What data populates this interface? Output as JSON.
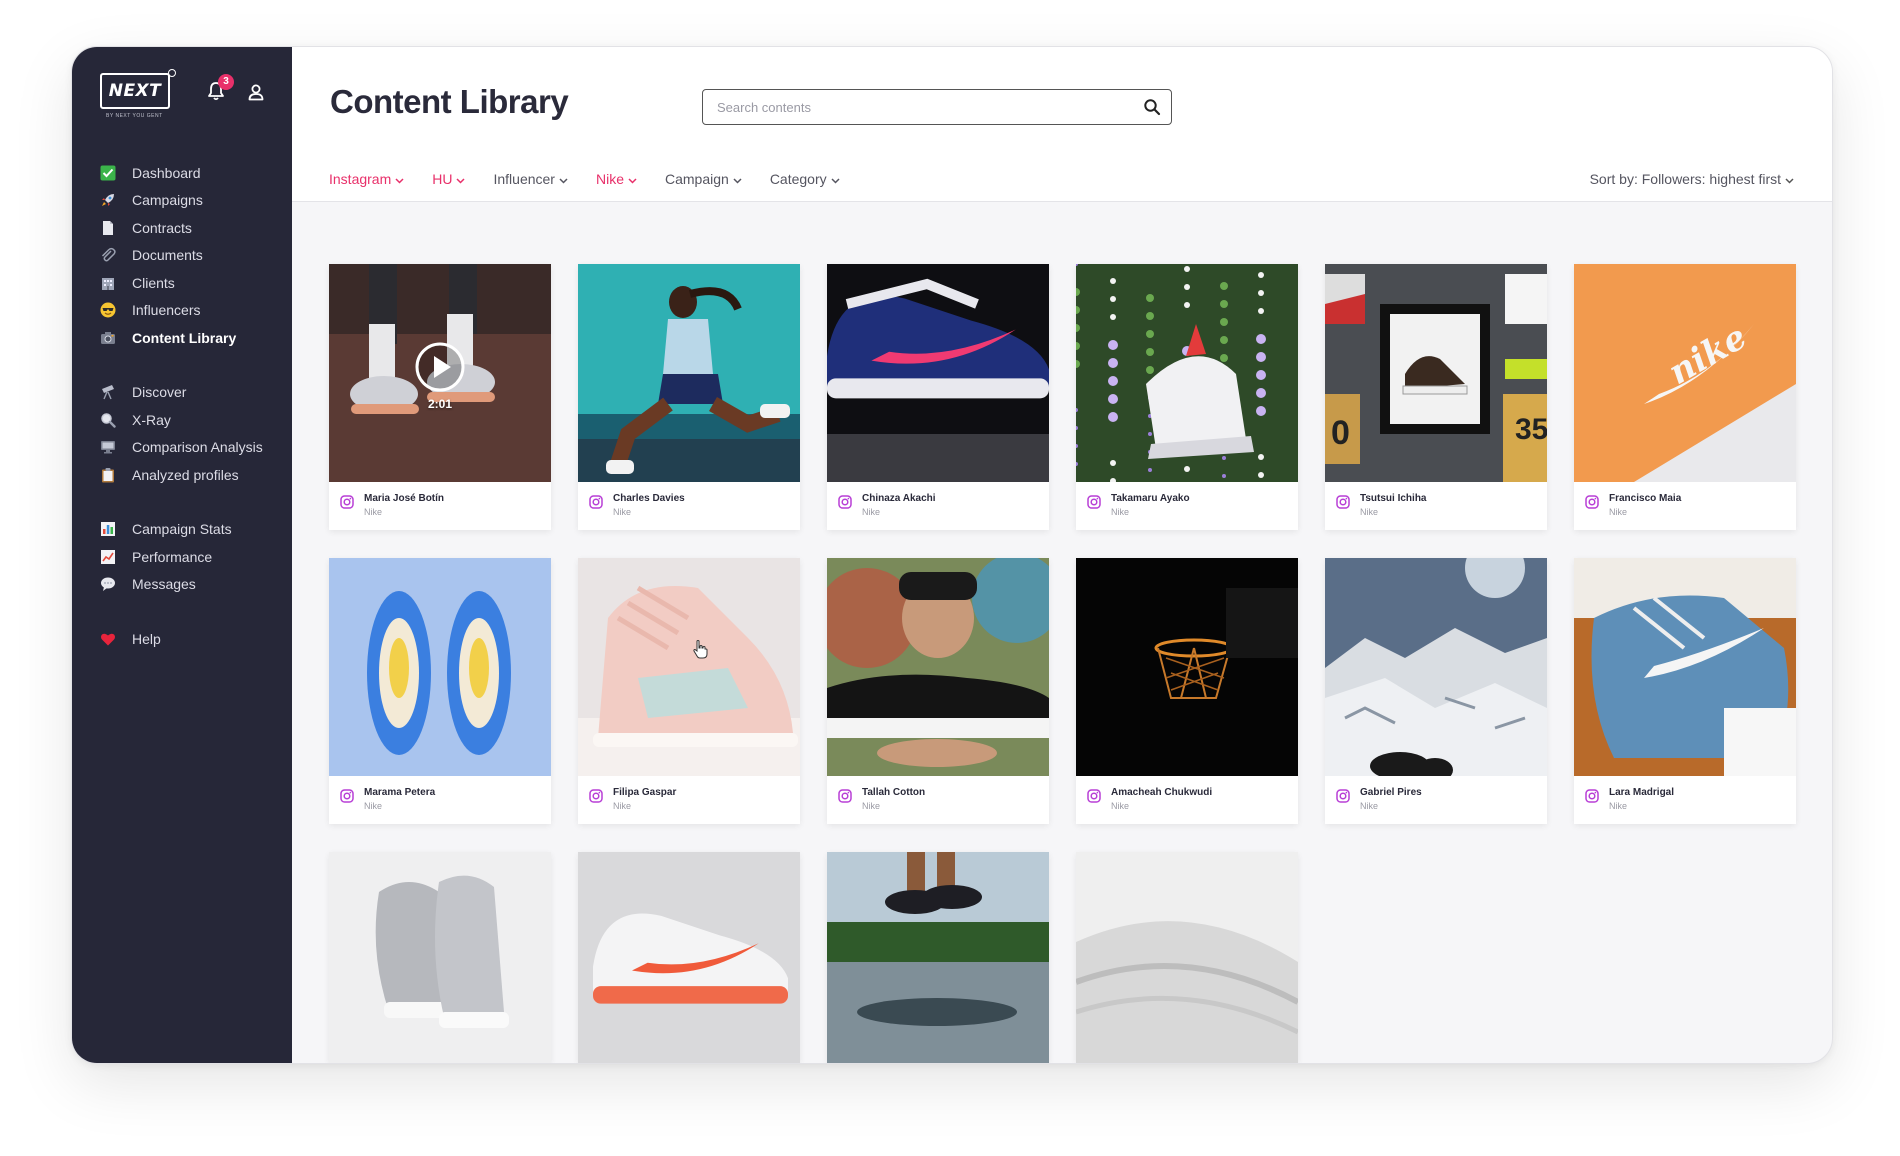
{
  "sidebar": {
    "logo_text": "NEXT",
    "logo_subtitle": "BY NEXT YOU GENT",
    "notification_count": "3",
    "nav_groups": [
      [
        {
          "label": "Dashboard",
          "icon": "check-box-icon"
        },
        {
          "label": "Campaigns",
          "icon": "rocket-icon"
        },
        {
          "label": "Contracts",
          "icon": "document-icon"
        },
        {
          "label": "Documents",
          "icon": "paperclip-icon"
        },
        {
          "label": "Clients",
          "icon": "building-icon"
        },
        {
          "label": "Influencers",
          "icon": "sunglasses-face-icon"
        },
        {
          "label": "Content Library",
          "icon": "camera-icon",
          "active": true
        }
      ],
      [
        {
          "label": "Discover",
          "icon": "telescope-icon"
        },
        {
          "label": "X-Ray",
          "icon": "magnifier-icon"
        },
        {
          "label": "Comparison Analysis",
          "icon": "monitor-icon"
        },
        {
          "label": "Analyzed profiles",
          "icon": "clipboard-icon"
        }
      ],
      [
        {
          "label": "Campaign Stats",
          "icon": "bar-chart-icon"
        },
        {
          "label": "Performance",
          "icon": "line-chart-icon"
        },
        {
          "label": "Messages",
          "icon": "speech-bubble-icon"
        }
      ],
      [
        {
          "label": "Help",
          "icon": "heart-icon"
        }
      ]
    ]
  },
  "header": {
    "title": "Content Library",
    "search_placeholder": "Search contents",
    "filters": [
      {
        "label": "Instagram",
        "active": true
      },
      {
        "label": "HU",
        "active": true
      },
      {
        "label": "Influencer",
        "active": false
      },
      {
        "label": "Nike",
        "active": true
      },
      {
        "label": "Campaign",
        "active": false
      },
      {
        "label": "Category",
        "active": false
      }
    ],
    "sort_label": "Sort by: Followers: highest first"
  },
  "video": {
    "duration": "2:01"
  },
  "cards": [
    {
      "name": "Maria José Botín",
      "brand": "Nike",
      "scene": "runner-feet",
      "video": true
    },
    {
      "name": "Charles Davies",
      "brand": "Nike",
      "scene": "runner-woman"
    },
    {
      "name": "Chinaza Akachi",
      "brand": "Nike",
      "scene": "sneaker-navy-pink"
    },
    {
      "name": "Takamaru Ayako",
      "brand": "Nike",
      "scene": "sneaker-flowers"
    },
    {
      "name": "Tsutsui Ichiha",
      "brand": "Nike",
      "scene": "sneaker-wall"
    },
    {
      "name": "Francisco Maia",
      "brand": "Nike",
      "scene": "orange-box"
    },
    {
      "name": "Marama Petera",
      "brand": "Nike",
      "scene": "blue-dunks"
    },
    {
      "name": "Filipa Gaspar",
      "brand": "Nike",
      "scene": "pink-jordan"
    },
    {
      "name": "Tallah Cotton",
      "brand": "Nike",
      "scene": "black-sneaker-hand"
    },
    {
      "name": "Amacheah Chukwudi",
      "brand": "Nike",
      "scene": "basketball-hoop"
    },
    {
      "name": "Gabriel Pires",
      "brand": "Nike",
      "scene": "snowy-mountains"
    },
    {
      "name": "Lara Madrigal",
      "brand": "Nike",
      "scene": "blue-sneaker-box"
    },
    {
      "scene": "silver-jordans",
      "partial": true
    },
    {
      "scene": "orange-air-max",
      "partial": true
    },
    {
      "scene": "jumping-feet",
      "partial": true
    },
    {
      "scene": "white-sneaker-closeup",
      "partial": true
    }
  ],
  "colors": {
    "sidebar_bg": "#262738",
    "accent": "#e8306a",
    "instagram_icon": "#b83fd6"
  }
}
